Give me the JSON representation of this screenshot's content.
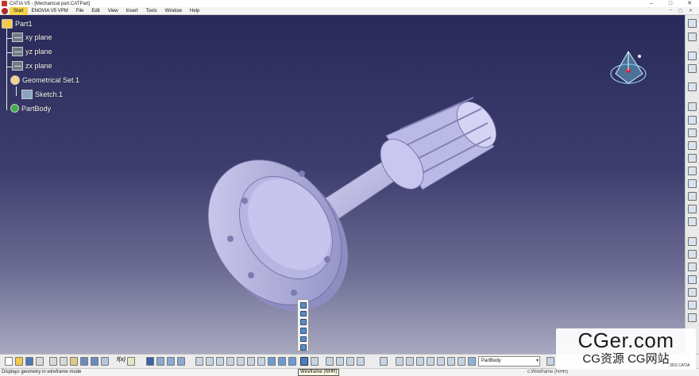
{
  "window": {
    "title": "CATIA V5 - [Mechanical part.CATPart]",
    "controls": {
      "minimize": "–",
      "maximize": "□",
      "close": "✕"
    }
  },
  "menu": {
    "items": [
      "Start",
      "ENOVIA V5 VPM",
      "File",
      "Edit",
      "View",
      "Insert",
      "Tools",
      "Window",
      "Help"
    ],
    "right_icons": [
      "–",
      "◻",
      "✕"
    ]
  },
  "tree": {
    "root": "Part1",
    "xy": "xy plane",
    "yz": "yz plane",
    "zx": "zx plane",
    "geoset": "Geometrical Set.1",
    "sketch": "Sketch.1",
    "body": "PartBody"
  },
  "toolbar": {
    "formula_label": "f(x)",
    "current_body": "PartBody",
    "body_dropdown_arrow": "▾"
  },
  "status": {
    "message": "Displays geometry in wireframe mode",
    "tooltip": "Wireframe (NHR)",
    "command": "c:Wireframe (NHR)"
  },
  "watermark": {
    "line1": "CGer.com",
    "line2": "CG资源 CG网站"
  },
  "corner_label": "3DS CATIA",
  "colors": {
    "viewport_top": "#2a2a5a",
    "viewport_bottom": "#a9a9c1",
    "part_face": "#c4c2ea",
    "part_shade": "#9593c6",
    "menu_active": "#f6d24a"
  }
}
